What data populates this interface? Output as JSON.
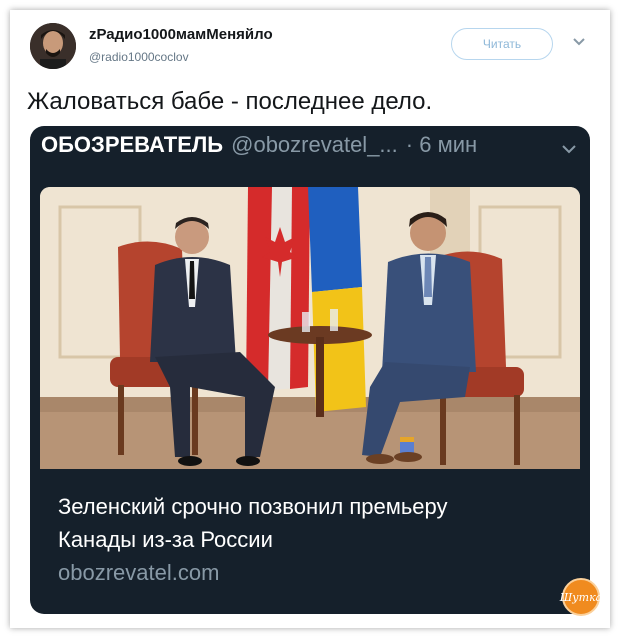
{
  "author": {
    "display_name": "zРадио1000мамМеняйло",
    "handle": "@radio1000coclov",
    "follow_label": "Читать"
  },
  "tweet": {
    "text": "Жаловаться бабе - последнее дело."
  },
  "quoted": {
    "name": "ОБОЗРЕВАТЕЛЬ",
    "handle": "@obozrevatel_...",
    "time": "· 6 мин",
    "link_title_line1": "Зеленский срочно позвонил премьеру",
    "link_title_line2": "Канады из-за России",
    "link_domain": "obozrevatel.com"
  },
  "watermark": {
    "text": "Шутка"
  },
  "icons": [
    "avatar",
    "chevron-down-icon",
    "canada-flag",
    "ukraine-flag",
    "watermark-logo"
  ],
  "colors": {
    "card_bg": "#15202b",
    "muted": "#8899a6",
    "accent": "#1da1f2",
    "watermark": "#f08b1f"
  }
}
